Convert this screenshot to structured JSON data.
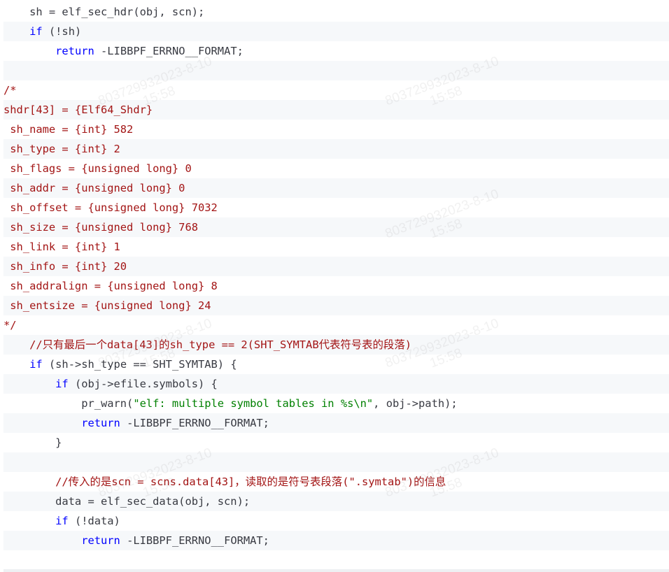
{
  "code": {
    "lines": [
      "    sh = elf_sec_hdr(obj, scn);",
      "    if (!sh)",
      "        return -LIBBPF_ERRNO__FORMAT;",
      "",
      "/*",
      "shdr[43] = {Elf64_Shdr}",
      " sh_name = {int} 582",
      " sh_type = {int} 2",
      " sh_flags = {unsigned long} 0",
      " sh_addr = {unsigned long} 0",
      " sh_offset = {unsigned long} 7032",
      " sh_size = {unsigned long} 768",
      " sh_link = {int} 1",
      " sh_info = {int} 20",
      " sh_addralign = {unsigned long} 8",
      " sh_entsize = {unsigned long} 24",
      "*/",
      "    //只有最后一个data[43]的sh_type == 2(SHT_SYMTAB代表符号表的段落)",
      "    if (sh->sh_type == SHT_SYMTAB) {",
      "        if (obj->efile.symbols) {",
      "            pr_warn(\"elf: multiple symbol tables in %s\\n\", obj->path);",
      "            return -LIBBPF_ERRNO__FORMAT;",
      "        }",
      "",
      "        //传入的是scn = scns.data[43]，读取的是符号表段落(\".symtab\")的信息",
      "        data = elf_sec_data(obj, scn);",
      "        if (!data)",
      "            return -LIBBPF_ERRNO__FORMAT;",
      ""
    ]
  },
  "watermark": {
    "id": "803729932023-8-10",
    "time": "15:58"
  },
  "colors": {
    "keyword": "#0000ff",
    "string": "#008000",
    "text": "#383a42",
    "shade": "#f6f8fa"
  }
}
